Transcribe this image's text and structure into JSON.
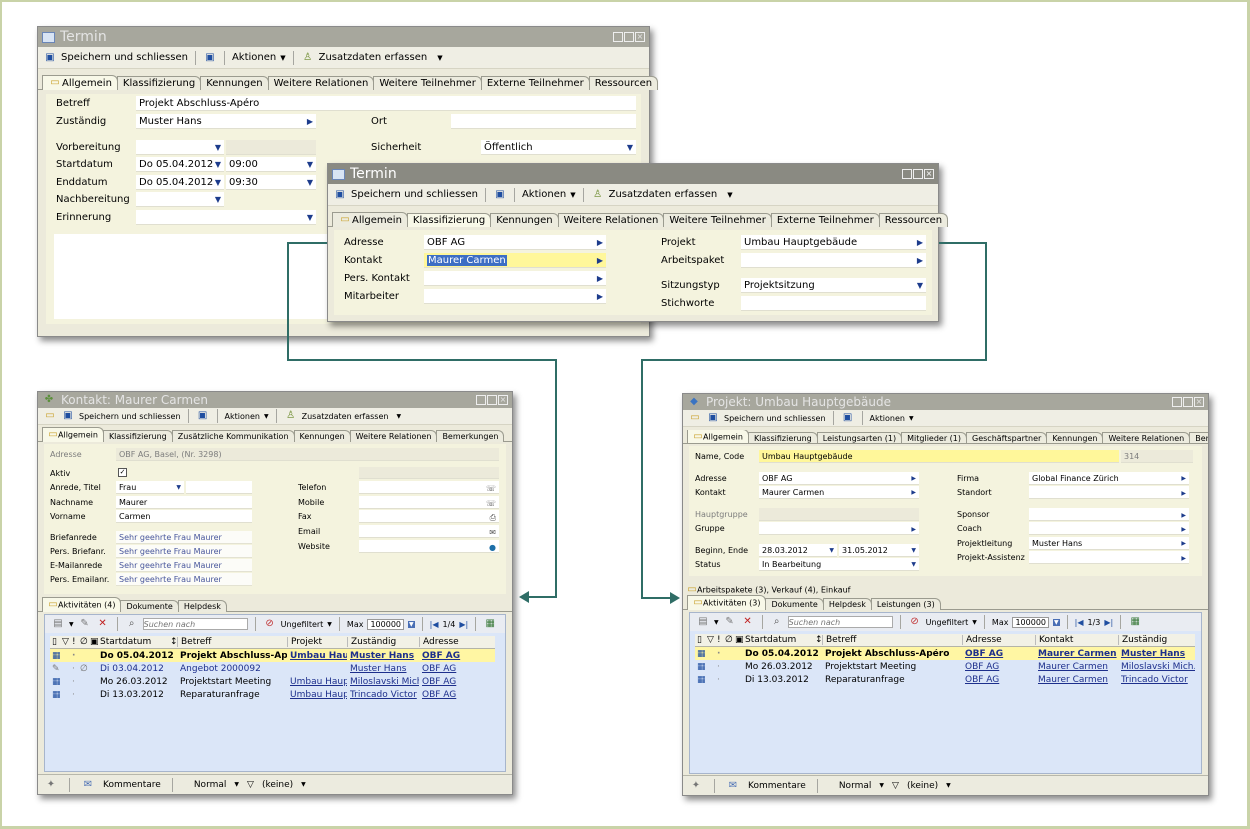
{
  "termin1": {
    "title": "Termin",
    "toolbar": {
      "save_close": "Speichern und schliessen",
      "actions": "Aktionen",
      "extra": "Zusatzdaten erfassen"
    },
    "tabs": [
      "Allgemein",
      "Klassifizierung",
      "Kennungen",
      "Weitere Relationen",
      "Weitere Teilnehmer",
      "Externe Teilnehmer",
      "Ressourcen"
    ],
    "fields": {
      "betreff_label": "Betreff",
      "betreff": "Projekt Abschluss-Apéro",
      "zustaendig_label": "Zuständig",
      "zustaendig": "Muster Hans",
      "ort_label": "Ort",
      "vorbereitung_label": "Vorbereitung",
      "sicherheit_label": "Sicherheit",
      "sicherheit": "Öffentlich",
      "startdatum_label": "Startdatum",
      "start_date": "Do 05.04.2012",
      "start_time": "09:00",
      "enddatum_label": "Enddatum",
      "end_date": "Do 05.04.2012",
      "end_time": "09:30",
      "nachbereitung_label": "Nachbereitung",
      "erinnerung_label": "Erinnerung"
    }
  },
  "termin2": {
    "title": "Termin",
    "toolbar": {
      "save_close": "Speichern und schliessen",
      "actions": "Aktionen",
      "extra": "Zusatzdaten erfassen"
    },
    "tabs": [
      "Allgemein",
      "Klassifizierung",
      "Kennungen",
      "Weitere Relationen",
      "Weitere Teilnehmer",
      "Externe Teilnehmer",
      "Ressourcen"
    ],
    "fields": {
      "adresse_label": "Adresse",
      "adresse": "OBF AG",
      "kontakt_label": "Kontakt",
      "kontakt": "Maurer Carmen",
      "pers_kontakt_label": "Pers. Kontakt",
      "mitarbeiter_label": "Mitarbeiter",
      "projekt_label": "Projekt",
      "projekt": "Umbau Hauptgebäude",
      "arbeitspaket_label": "Arbeitspaket",
      "sitzungstyp_label": "Sitzungstyp",
      "sitzungstyp": "Projektsitzung",
      "stichworte_label": "Stichworte"
    }
  },
  "kontakt": {
    "title": "Kontakt: Maurer Carmen",
    "toolbar": {
      "save_close": "Speichern und schliessen",
      "actions": "Aktionen",
      "extra": "Zusatzdaten erfassen"
    },
    "tabs": [
      "Allgemein",
      "Klassifizierung",
      "Zusätzliche Kommunikation",
      "Kennungen",
      "Weitere Relationen",
      "Bemerkungen"
    ],
    "fields": {
      "adresse_label": "Adresse",
      "adresse": "OBF AG, Basel, (Nr. 3298)",
      "aktiv_label": "Aktiv",
      "anrede_label": "Anrede, Titel",
      "anrede": "Frau",
      "nachname_label": "Nachname",
      "nachname": "Maurer",
      "vorname_label": "Vorname",
      "vorname": "Carmen",
      "briefanrede_label": "Briefanrede",
      "briefanrede": "Sehr geehrte Frau Maurer",
      "pers_briefanr_label": "Pers. Briefanr.",
      "pers_briefanr": "Sehr geehrte Frau Maurer",
      "emailanrede_label": "E-Mailanrede",
      "emailanrede": "Sehr geehrte Frau Maurer",
      "pers_emailanr_label": "Pers. Emailanr.",
      "pers_emailanr": "Sehr geehrte Frau Maurer",
      "telefon_label": "Telefon",
      "mobile_label": "Mobile",
      "fax_label": "Fax",
      "email_label": "Email",
      "website_label": "Website"
    },
    "subtabs": [
      "Aktivitäten (4)",
      "Dokumente",
      "Helpdesk"
    ],
    "gridbar": {
      "search_placeholder": "Suchen nach",
      "filter": "Ungefiltert",
      "max_label": "Max",
      "max": "100000",
      "pager": "1/4"
    },
    "columns": [
      "Startdatum",
      "Betreff",
      "Projekt",
      "Zuständig",
      "Adresse"
    ],
    "rows": [
      {
        "date": "Do 05.04.2012",
        "betreff": "Projekt Abschluss-Apéro",
        "projekt": "Umbau Hau...",
        "zust": "Muster Hans",
        "adr": "OBF AG"
      },
      {
        "date": "Di 03.04.2012",
        "betreff": "Angebot 2000092",
        "projekt": "",
        "zust": "Muster Hans",
        "adr": "OBF AG"
      },
      {
        "date": "Mo 26.03.2012",
        "betreff": "Projektstart Meeting",
        "projekt": "Umbau Haupt...",
        "zust": "Miloslavski Mich...",
        "adr": "OBF AG"
      },
      {
        "date": "Di 13.03.2012",
        "betreff": "Reparaturanfrage",
        "projekt": "Umbau Haupt...",
        "zust": "Trincado Victor",
        "adr": "OBF AG"
      }
    ],
    "status": {
      "comments": "Kommentare",
      "priority": "Normal",
      "flag": "(keine)"
    }
  },
  "projekt": {
    "title": "Projekt: Umbau Hauptgebäude",
    "toolbar": {
      "save_close": "Speichern und schliessen",
      "actions": "Aktionen"
    },
    "tabs": [
      "Allgemein",
      "Klassifizierung",
      "Leistungsarten (1)",
      "Mitglieder (1)",
      "Geschäftspartner",
      "Kennungen",
      "Weitere Relationen",
      "Bemerkun"
    ],
    "fields": {
      "name_label": "Name, Code",
      "name": "Umbau Hauptgebäude",
      "code": "314",
      "adresse_label": "Adresse",
      "adresse": "OBF AG",
      "kontakt_label": "Kontakt",
      "kontakt": "Maurer Carmen",
      "firma_label": "Firma",
      "firma": "Global Finance Zürich",
      "standort_label": "Standort",
      "hauptgruppe_label": "Hauptgruppe",
      "gruppe_label": "Gruppe",
      "sponsor_label": "Sponsor",
      "coach_label": "Coach",
      "projektleitung_label": "Projektleitung",
      "projektleitung": "Muster Hans",
      "projektassistenz_label": "Projekt-Assistenz",
      "beginn_label": "Beginn, Ende",
      "beginn": "28.03.2012",
      "ende": "31.05.2012",
      "status_label": "Status",
      "status": "In Bearbeitung"
    },
    "section": "Arbeitspakete (3), Verkauf (4), Einkauf",
    "subtabs": [
      "Aktivitäten (3)",
      "Dokumente",
      "Helpdesk",
      "Leistungen (3)"
    ],
    "gridbar": {
      "search_placeholder": "Suchen nach",
      "filter": "Ungefiltert",
      "max_label": "Max",
      "max": "100000",
      "pager": "1/3"
    },
    "columns": [
      "Startdatum",
      "Betreff",
      "Adresse",
      "Kontakt",
      "Zuständig"
    ],
    "rows": [
      {
        "date": "Do 05.04.2012",
        "betreff": "Projekt Abschluss-Apéro",
        "adr": "OBF AG",
        "kontakt": "Maurer Carmen",
        "zust": "Muster Hans"
      },
      {
        "date": "Mo 26.03.2012",
        "betreff": "Projektstart Meeting",
        "adr": "OBF AG",
        "kontakt": "Maurer Carmen",
        "zust": "Miloslavski Mich..."
      },
      {
        "date": "Di 13.03.2012",
        "betreff": "Reparaturanfrage",
        "adr": "OBF AG",
        "kontakt": "Maurer Carmen",
        "zust": "Trincado Victor"
      }
    ],
    "status": {
      "comments": "Kommentare",
      "priority": "Normal",
      "flag": "(keine)"
    }
  },
  "colors": {
    "selected_row": "#fff6a3",
    "grid_bg": "#dbe6f8",
    "pane_bg": "#f4f3de",
    "connector": "#2f6d66"
  }
}
